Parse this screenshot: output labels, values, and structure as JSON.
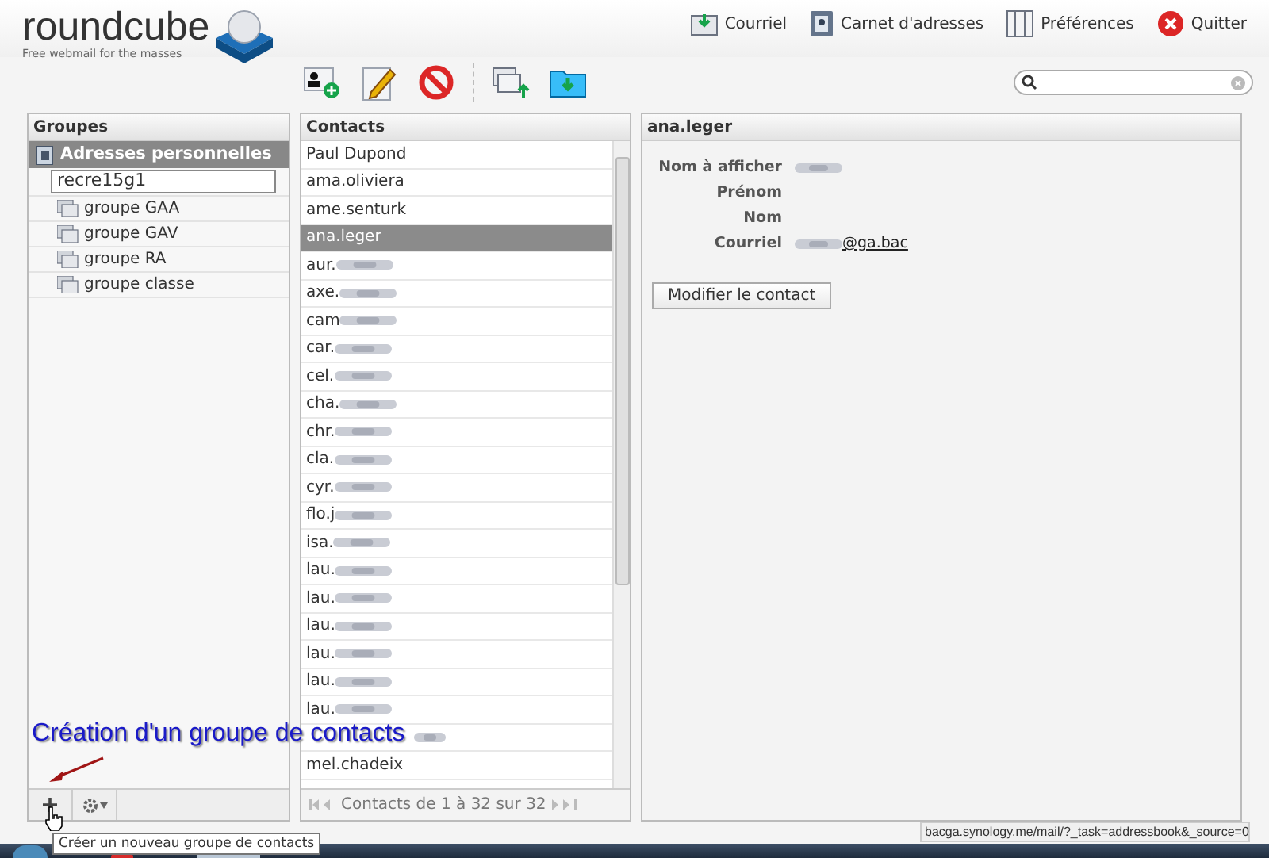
{
  "logo": {
    "name": "roundcube",
    "tagline": "Free webmail for the masses"
  },
  "top_nav": [
    {
      "label": "Courriel",
      "kind": "mail"
    },
    {
      "label": "Carnet d'adresses",
      "kind": "book"
    },
    {
      "label": "Préférences",
      "kind": "prefs"
    },
    {
      "label": "Quitter",
      "kind": "quit"
    }
  ],
  "toolbar": [
    {
      "kind": "add"
    },
    {
      "kind": "edit"
    },
    {
      "kind": "delete"
    },
    {
      "kind": "import"
    },
    {
      "kind": "export"
    }
  ],
  "groups": {
    "title": "Groupes",
    "source": "Adresses personnelles",
    "new_group_value": "recre15g1",
    "items": [
      {
        "label": "groupe GAA"
      },
      {
        "label": "groupe GAV"
      },
      {
        "label": "groupe RA"
      },
      {
        "label": "groupe classe"
      }
    ]
  },
  "contacts": {
    "title": "Contacts",
    "pager": "Contacts de 1 à 32 sur 32",
    "rows": [
      {
        "name": "Paul Dupond",
        "blurred": false,
        "selected": false
      },
      {
        "name": "ama.oliviera",
        "blurred": false,
        "selected": false
      },
      {
        "name": "ame.senturk",
        "blurred": false,
        "selected": false
      },
      {
        "name": "ana.leger",
        "blurred": false,
        "selected": true
      },
      {
        "name": "aur.",
        "blurred": true,
        "selected": false
      },
      {
        "name": "axe.",
        "blurred": true,
        "selected": false
      },
      {
        "name": "cam",
        "blurred": true,
        "selected": false
      },
      {
        "name": "car.",
        "blurred": true,
        "selected": false
      },
      {
        "name": "cel.",
        "blurred": true,
        "selected": false
      },
      {
        "name": "cha.",
        "blurred": true,
        "selected": false
      },
      {
        "name": "chr.",
        "blurred": true,
        "selected": false
      },
      {
        "name": "cla.",
        "blurred": true,
        "selected": false
      },
      {
        "name": "cyr.",
        "blurred": true,
        "selected": false
      },
      {
        "name": "flo.j",
        "blurred": true,
        "selected": false
      },
      {
        "name": "isa.",
        "blurred": true,
        "selected": false
      },
      {
        "name": "lau.",
        "blurred": true,
        "selected": false
      },
      {
        "name": "lau.",
        "blurred": true,
        "selected": false
      },
      {
        "name": "lau.",
        "blurred": true,
        "selected": false
      },
      {
        "name": "lau.",
        "blurred": true,
        "selected": false
      },
      {
        "name": "lau.",
        "blurred": true,
        "selected": false
      },
      {
        "name": "lau.",
        "blurred": true,
        "selected": false
      },
      {
        "blurred": true,
        "selected": false
      },
      {
        "name": "mel.chadeix",
        "blurred": false,
        "selected": false
      }
    ]
  },
  "detail": {
    "title": "ana.leger",
    "fields": [
      {
        "label": "Nom à afficher",
        "blurred": true
      },
      {
        "label": "Prénom",
        "blurred": false
      },
      {
        "label": "Nom",
        "blurred": false
      },
      {
        "label": "Courriel",
        "blurred": true,
        "link": "@ga.bac"
      }
    ],
    "button": "Modifier le contact"
  },
  "annotation": "Création d'un groupe de contacts",
  "tooltip": "Créer un nouveau groupe de contacts",
  "status_url": "bacga.synology.me/mail/?_task=addressbook&_source=0"
}
